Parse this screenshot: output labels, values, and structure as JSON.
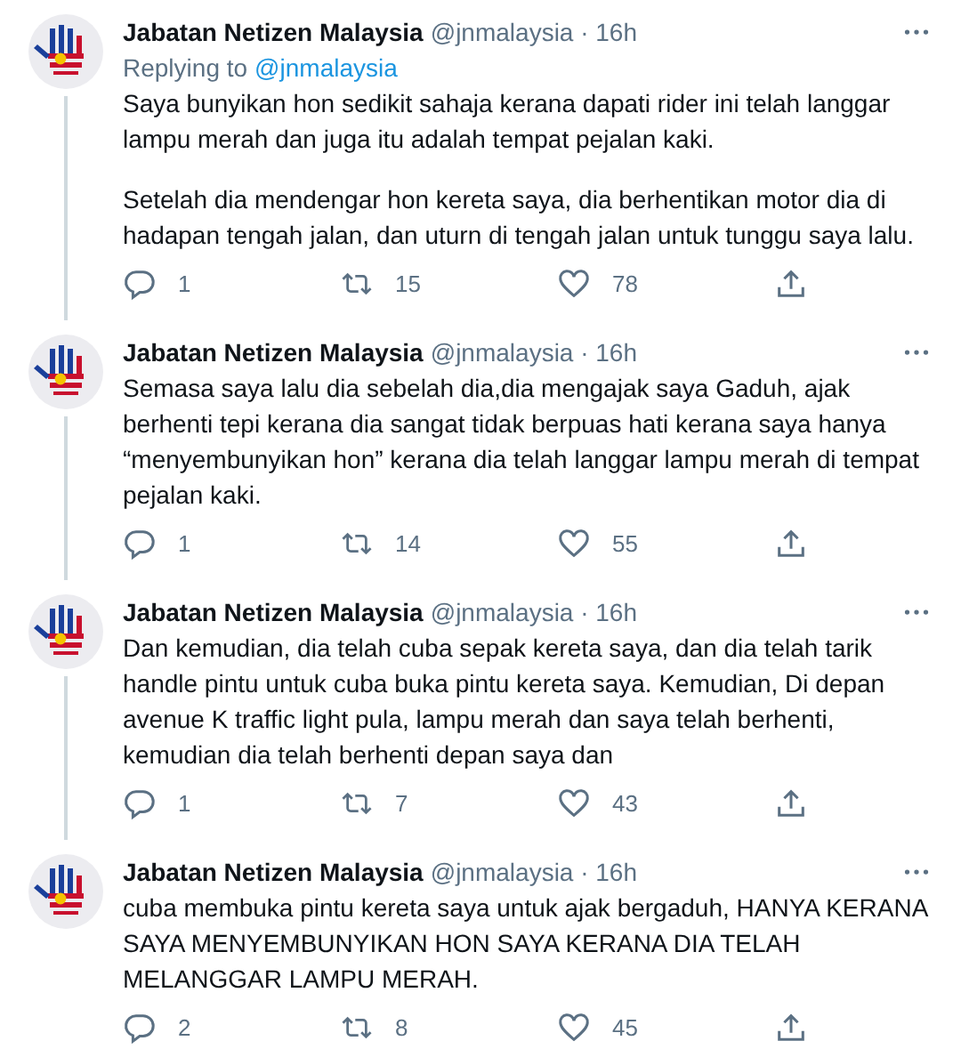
{
  "tweets": [
    {
      "name": "Jabatan Netizen Malaysia",
      "meta": "@jnmalaysia · 16h",
      "replying_to": {
        "prefix": "Replying to",
        "handle": "@jnmalaysia"
      },
      "paragraphs": [
        "Saya bunyikan hon sedikit sahaja kerana dapati rider ini telah langgar lampu merah dan juga itu adalah tempat pejalan kaki.",
        "Setelah dia mendengar hon kereta saya, dia berhentikan motor dia di hadapan tengah jalan, dan uturn di tengah jalan untuk tunggu saya lalu."
      ],
      "replies": "1",
      "retweets": "15",
      "likes": "78",
      "thread_continues": true
    },
    {
      "name": "Jabatan Netizen Malaysia",
      "meta": "@jnmalaysia · 16h",
      "paragraphs": [
        "Semasa saya lalu dia sebelah dia,dia mengajak saya Gaduh, ajak berhenti tepi kerana dia sangat tidak berpuas hati kerana saya hanya “menyembunyikan hon” kerana dia telah langgar lampu merah di tempat pejalan kaki."
      ],
      "replies": "1",
      "retweets": "14",
      "likes": "55",
      "thread_continues": true
    },
    {
      "name": "Jabatan Netizen Malaysia",
      "meta": "@jnmalaysia · 16h",
      "paragraphs": [
        "Dan kemudian, dia telah cuba sepak kereta saya, dan dia telah tarik handle pintu untuk cuba buka pintu kereta saya. Kemudian, Di depan avenue K traffic light pula, lampu merah dan saya telah berhenti, kemudian dia telah berhenti depan saya dan"
      ],
      "replies": "1",
      "retweets": "7",
      "likes": "43",
      "thread_continues": true
    },
    {
      "name": "Jabatan Netizen Malaysia",
      "meta": "@jnmalaysia · 16h",
      "paragraphs": [
        "cuba membuka pintu kereta saya untuk ajak bergaduh, HANYA KERANA SAYA MENYEMBUNYIKAN HON SAYA KERANA DIA TELAH MELANGGAR LAMPU MERAH."
      ],
      "replies": "2",
      "retweets": "8",
      "likes": "45",
      "thread_continues": false
    }
  ]
}
